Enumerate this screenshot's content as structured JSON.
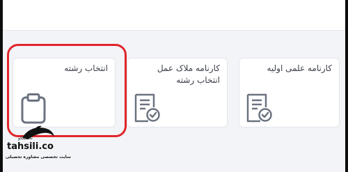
{
  "cards": [
    {
      "label": "انتخاب رشته",
      "icon": "clipboard-icon"
    },
    {
      "label": "کارنامه ملاک عمل انتخاب رشته",
      "icon": "report-check-icon"
    },
    {
      "label": "کارنامه علمی اولیه",
      "icon": "report-check-icon"
    }
  ],
  "watermark": {
    "brand": "تحصیلکو",
    "name": "tahsili.co",
    "tagline": "سایت تخصصی مشاوره تحصیلی"
  },
  "colors": {
    "highlight": "#e0252b",
    "icon": "#6b7280",
    "icon_check": "#7a8089"
  }
}
